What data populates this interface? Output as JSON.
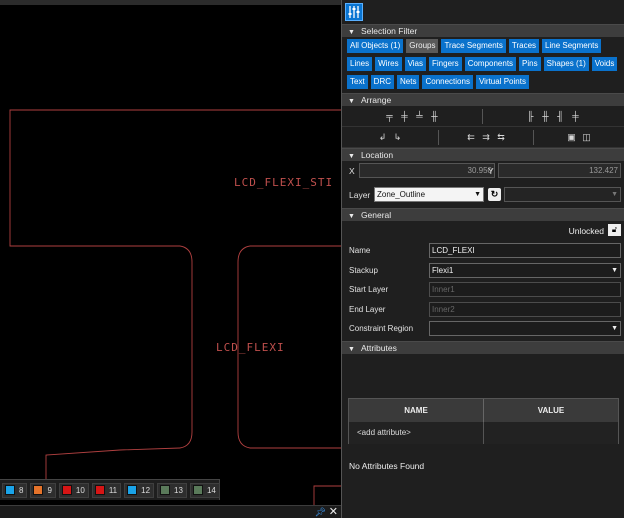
{
  "canvas": {
    "labels": [
      "LCD_FLEXI_STI",
      "LCD_FLEXI"
    ]
  },
  "layer_bar": [
    {
      "num": "8",
      "color": "#1aa3e8"
    },
    {
      "num": "9",
      "color": "#e5732a"
    },
    {
      "num": "10",
      "color": "#d61515"
    },
    {
      "num": "11",
      "color": "#d61515"
    },
    {
      "num": "12",
      "color": "#1aa3e8"
    },
    {
      "num": "13",
      "color": "#5a7a5a"
    },
    {
      "num": "14",
      "color": "#5a7a5a"
    }
  ],
  "bottom_strip": {
    "pin_icon": "pin-icon",
    "close_glyph": "✕"
  },
  "panel": {
    "toolbar_icon": "filter-sliders-icon",
    "selection_filter": {
      "title": "Selection Filter",
      "chips": [
        {
          "label": "All Objects (1)",
          "style": "blue"
        },
        {
          "label": "Groups",
          "style": "grey"
        },
        {
          "label": "Trace Segments",
          "style": "blue"
        },
        {
          "label": "Traces",
          "style": "blue"
        },
        {
          "label": "Line Segments",
          "style": "blue"
        },
        {
          "label": "Lines",
          "style": "blue"
        },
        {
          "label": "Wires",
          "style": "blue"
        },
        {
          "label": "Vias",
          "style": "blue"
        },
        {
          "label": "Fingers",
          "style": "blue"
        },
        {
          "label": "Components",
          "style": "blue"
        },
        {
          "label": "Pins",
          "style": "blue"
        },
        {
          "label": "Shapes (1)",
          "style": "blue"
        },
        {
          "label": "Voids",
          "style": "blue"
        },
        {
          "label": "Text",
          "style": "blue"
        },
        {
          "label": "DRC",
          "style": "blue"
        },
        {
          "label": "Nets",
          "style": "blue"
        },
        {
          "label": "Connections",
          "style": "blue"
        },
        {
          "label": "Virtual Points",
          "style": "blue"
        }
      ]
    },
    "arrange": {
      "title": "Arrange"
    },
    "location": {
      "title": "Location",
      "x_label": "X",
      "x_value": "30.950",
      "y_label": "Y",
      "y_value": "132.427",
      "layer_label": "Layer",
      "layer_value": "Zone_Outline"
    },
    "general": {
      "title": "General",
      "lock_text": "Unlocked",
      "name_label": "Name",
      "name_value": "LCD_FLEXI",
      "stackup_label": "Stackup",
      "stackup_value": "Flexi1",
      "start_label": "Start Layer",
      "start_value": "Inner1",
      "end_label": "End Layer",
      "end_value": "Inner2",
      "constraint_label": "Constraint Region",
      "constraint_value": ""
    },
    "attributes": {
      "title": "Attributes",
      "col_name": "NAME",
      "col_value": "VALUE",
      "add_row": "<add attribute>",
      "empty_text": "No Attributes Found"
    }
  }
}
